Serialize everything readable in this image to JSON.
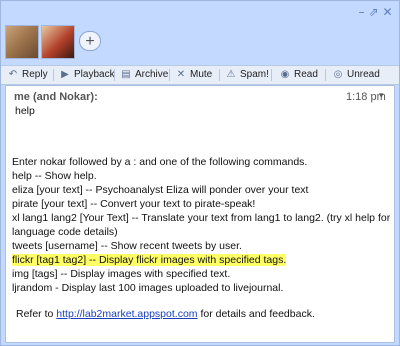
{
  "window": {
    "controls": {
      "minimize": "–",
      "maximize": "⇗",
      "close": "✕"
    }
  },
  "participants": {
    "add_button": "+"
  },
  "toolbar": {
    "reply": "Reply",
    "playback": "Playback",
    "archive": "Archive",
    "mute": "Mute",
    "spam": "Spam!",
    "read": "Read",
    "unread": "Unread",
    "icons": [
      "reply-icon",
      "playback-icon",
      "archive-icon",
      "mute-icon",
      "spam-icon",
      "read-icon",
      "unread-icon"
    ]
  },
  "message": {
    "sender": "me (and Nokar):",
    "time": "1:18 pm",
    "body": "help",
    "lines": [
      "Enter nokar followed by a : and one of the following commands.",
      "help -- Show help.",
      "eliza [your text] -- Psychoanalyst Eliza will ponder over your text",
      "pirate [your text] -- Convert your text to pirate-speak!",
      "xl lang1 lang2 [Your Text] -- Translate your text from lang1 to lang2. (try xl help for",
      "language code details)",
      "tweets [username] -- Show recent tweets by user.",
      "flickr [tag1 tag2] -- Display flickr images with specified tags.",
      "img [tags] -- Display images with specified text.",
      "ljrandom - Display last 100 images uploaded to livejournal."
    ],
    "refer_prefix": "Refer to",
    "refer_link": "http://lab2market.appspot.com",
    "refer_suffix": "for details and feedback."
  }
}
